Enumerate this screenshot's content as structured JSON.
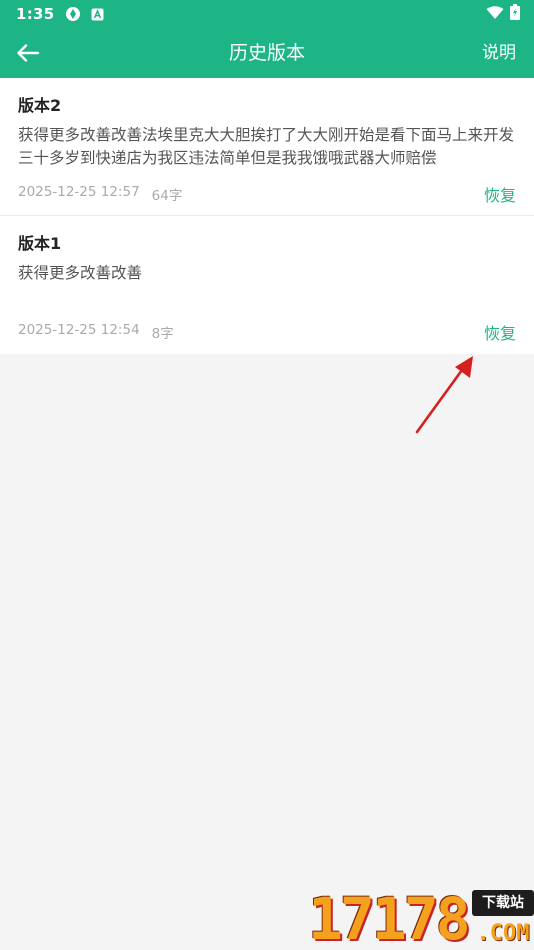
{
  "status_bar": {
    "time": "1:35",
    "icons": [
      "sync-icon",
      "a-badge-icon",
      "wifi-icon",
      "battery-icon"
    ]
  },
  "toolbar": {
    "title": "历史版本",
    "help_label": "说明",
    "back_icon": "arrow-left-icon"
  },
  "versions": [
    {
      "title": "版本2",
      "content": "获得更多改善改善法埃里克大大胆挨打了大大刚开始是看下面马上来开发三十多岁到快递店为我区违法简单但是我我饿哦武器大师赔偿",
      "timestamp": "2025-12-25 12:57",
      "char_count": "64字",
      "restore_label": "恢复"
    },
    {
      "title": "版本1",
      "content": "获得更多改善改善",
      "timestamp": "2025-12-25 12:54",
      "char_count": "8字",
      "restore_label": "恢复"
    }
  ],
  "watermark": {
    "digits": "17178",
    "tag": "下载站",
    "domain": ".COM"
  },
  "colors": {
    "accent": "#1db486",
    "background": "#f4f4f4",
    "annotation_arrow": "#d61f1f"
  }
}
